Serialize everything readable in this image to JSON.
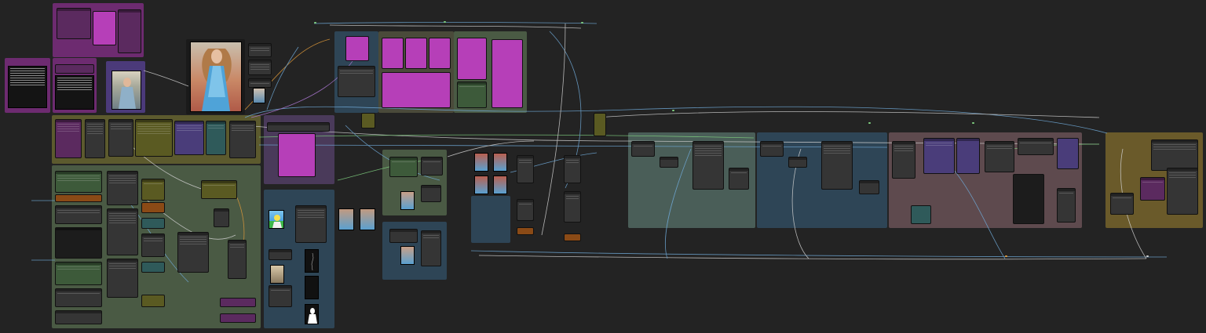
{
  "app": {
    "name": "node-graph-canvas"
  },
  "colors": {
    "background": "#232323",
    "group_purple": "#6d2b70",
    "group_olive": "#5c5a2e",
    "group_green": "#4a5a44",
    "group_blue": "#2e4556",
    "group_teal": "#4a5e58",
    "group_rose": "#5e4a4e",
    "group_gold": "#6a5a2a",
    "wire_blue": "#6fa8d6",
    "wire_orange": "#e09a3a",
    "wire_green": "#7fcf7f",
    "wire_purple": "#b07ad8",
    "wire_white": "#d0d0d0"
  },
  "icons": [
    "reference-image-icon",
    "output-image-icon",
    "mask-image-icon",
    "pose-image-icon"
  ]
}
